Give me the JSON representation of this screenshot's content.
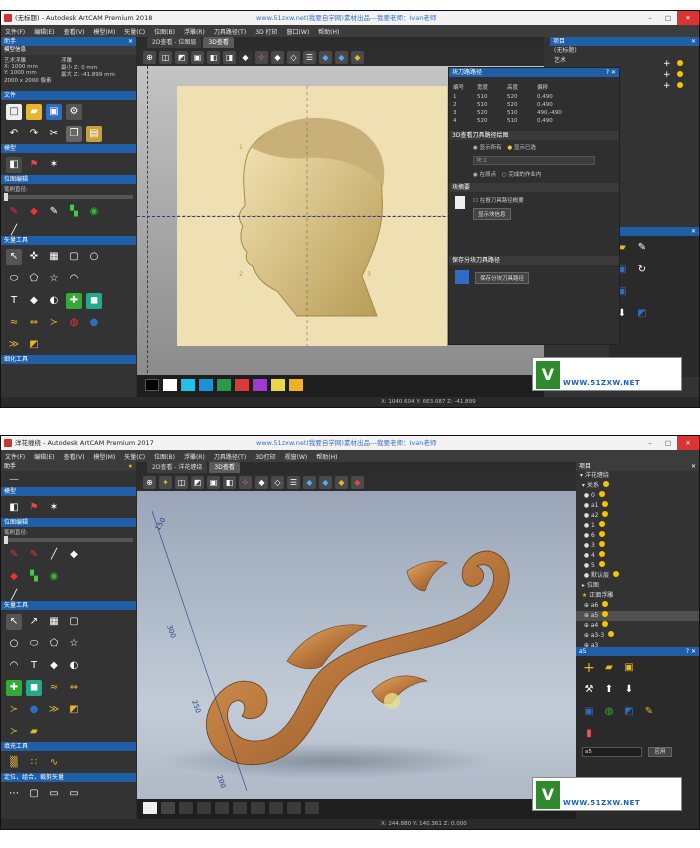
{
  "w1": {
    "title": "(无标题) - Autodesk ArtCAM Premium 2018",
    "url": "www.51zxw.net(我要自学网)素材出品---我要老师：Ivan老师",
    "menu": [
      "文件(F)",
      "编辑(E)",
      "查看(V)",
      "模型(M)",
      "矢量(C)",
      "位图(B)",
      "浮雕(R)",
      "刀具路径(T)",
      "3D 打印",
      "窗口(W)",
      "帮助(H)"
    ],
    "panel_title": "助手",
    "model_info": {
      "label": "模型信息",
      "name": "艺术浮雕",
      "x": "X: 1000 mm",
      "y": "Y: 1000 mm",
      "px": "2000 x 2000 像素",
      "sub": "浮雕",
      "zmin": "最小 Z: 0 mm",
      "zmax": "最大 Z: -41.899 mm"
    },
    "sections": [
      "文件",
      "模型",
      "位图编辑",
      "矢量工具",
      "细化工具"
    ],
    "bitmap_label": "笔刷直径:",
    "tabs": [
      "2D查看 - 位图层",
      "3D查看"
    ],
    "numbers": [
      "1",
      "2",
      "3"
    ],
    "status": "X: 1040.604   Y: 663.087   Z: -41.899",
    "right_panel": "项目",
    "right_items": [
      "(无标题)",
      "艺术"
    ],
    "dialog": {
      "title": "块刀路路径",
      "cols": [
        "编号",
        "宽度",
        "高度",
        "偏移"
      ],
      "rows": [
        [
          "1",
          "510",
          "520",
          "0,490"
        ],
        [
          "2",
          "510",
          "520",
          "0,490"
        ],
        [
          "3",
          "520",
          "510",
          "490,-490"
        ],
        [
          "4",
          "520",
          "510",
          "0,490"
        ]
      ],
      "s1": "3D查看刀具路径绘图",
      "r1": "显示所有",
      "r2": "显示已选",
      "sel": "块:1",
      "r3": "在原点",
      "r4": "完成的作业内",
      "s2": "块摘要",
      "chk": "在报刀具路径概要",
      "btn1": "显示块信息",
      "s3": "保存分块刀具路径",
      "btn2": "保存分块刀具路径"
    },
    "logo_url": "WWW.51ZXW.NET"
  },
  "w2": {
    "title": "洋花缠绕 - Autodesk ArtCAM Premium 2017",
    "url": "www.51zxw.net(我要自学网)素材出品---我要老师：Ivan老师",
    "menu": [
      "文件(F)",
      "编辑(E)",
      "查看(V)",
      "模型(M)",
      "矢量(C)",
      "位图(B)",
      "浮雕(R)",
      "刀具路径(T)",
      "3D打印",
      "视窗(W)",
      "帮助(H)"
    ],
    "panel_title": "助手",
    "sections": [
      "模型",
      "位图编辑",
      "矢量工具",
      "填充工具",
      "定位，组合，裁剪矢量"
    ],
    "bitmap_label": "笔刷直径:",
    "tabs": [
      "2D查看 - 洋花缠绕",
      "3D查看"
    ],
    "ruler": [
      "150",
      "300",
      "250",
      "200"
    ],
    "status": "X: 244.880   Y: 140.361   Z: 0.000",
    "right_panel": "项目",
    "tree": [
      "洋花缠绕",
      "关系",
      "0",
      "a1",
      "a2",
      "1",
      "6",
      "3",
      "4",
      "5",
      "默认层",
      "位图",
      "正面浮雕",
      "a6",
      "a5",
      "a4",
      "a3-3",
      "a3"
    ],
    "sub_panel": "a5",
    "name_field": "a5",
    "apply": "应用",
    "logo_url": "WWW.51ZXW.NET"
  }
}
